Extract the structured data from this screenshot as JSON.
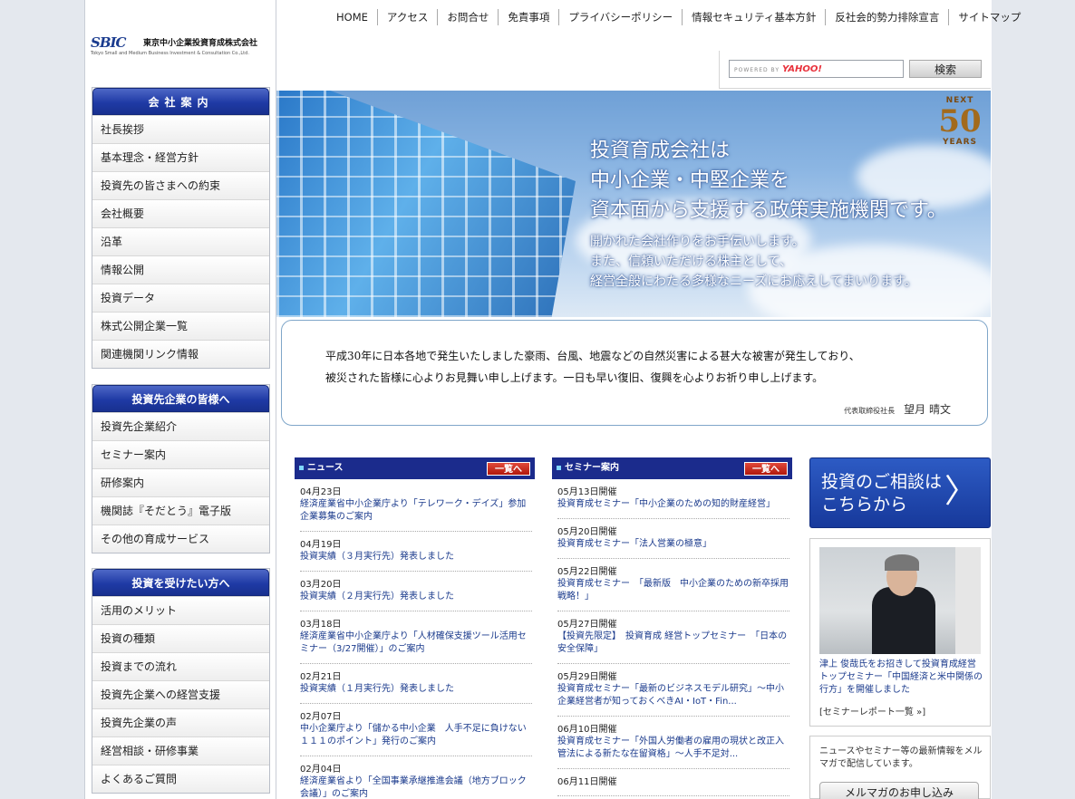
{
  "logo": {
    "mark": "SBIC",
    "name_jp": "東京中小企業投資育成株式会社",
    "name_en": "Tokyo Small and Medium Business Investment & Consultation Co.,Ltd."
  },
  "topnav": [
    "HOME",
    "アクセス",
    "お問合せ",
    "免責事項",
    "プライバシーポリシー",
    "情報セキュリティ基本方針",
    "反社会的勢力排除宣言",
    "サイトマップ"
  ],
  "search": {
    "powered_by": "POWERED BY",
    "provider": "YAHOO!",
    "button": "検索"
  },
  "menus": [
    {
      "title": "会社案内",
      "items": [
        "社長挨拶",
        "基本理念・経営方針",
        "投資先の皆さまへの約束",
        "会社概要",
        "沿革",
        "情報公開",
        "投資データ",
        "株式公開企業一覧",
        "関連機関リンク情報"
      ]
    },
    {
      "title": "投資先企業の皆様へ",
      "items": [
        "投資先企業紹介",
        "セミナー案内",
        "研修案内",
        "機関誌『そだとう』電子版",
        "その他の育成サービス"
      ]
    },
    {
      "title": "投資を受けたい方へ",
      "items": [
        "活用のメリット",
        "投資の種類",
        "投資までの流れ",
        "投資先企業への経営支援",
        "投資先企業の声",
        "経営相談・研修事業",
        "よくあるご質問"
      ]
    }
  ],
  "hero": {
    "headline": [
      "投資育成会社は",
      "中小企業・中堅企業を",
      "資本面から支援する政策実施機関です。"
    ],
    "sub": [
      "開かれた会社作りをお手伝いします。",
      "また、信頼いただける株主として、",
      "経営全般にわたる多様なニーズにお応えしてまいります。"
    ],
    "badge": {
      "top": "NEXT",
      "number": "50",
      "bottom": "YEARS"
    }
  },
  "message": {
    "line1": "平成30年に日本各地で発生いたしました豪雨、台風、地震などの自然災害による甚大な被害が発生しており、",
    "line2": "被災された皆様に心よりお見舞い申し上げます。一日も早い復旧、復興を心よりお祈り申し上げます。",
    "sig_title": "代表取締役社長",
    "sig_name": "望月 晴文"
  },
  "news": {
    "title": "ニュース",
    "more": "一覧へ",
    "items": [
      {
        "date": "04月23日",
        "text": "経済産業省中小企業庁より「テレワーク・デイズ」参加企業募集のご案内"
      },
      {
        "date": "04月19日",
        "text": "投資実績（３月実行先）発表しました"
      },
      {
        "date": "03月20日",
        "text": "投資実績（２月実行先）発表しました"
      },
      {
        "date": "03月18日",
        "text": "経済産業省中小企業庁より「人材確保支援ツール活用セミナー（3/27開催）」のご案内"
      },
      {
        "date": "02月21日",
        "text": "投資実績（１月実行先）発表しました"
      },
      {
        "date": "02月07日",
        "text": "中小企業庁より「儲かる中小企業　人手不足に負けない１１１のポイント」発行のご案内"
      },
      {
        "date": "02月04日",
        "text": "経済産業省より「全国事業承継推進会議（地方ブロック会議）」のご案内"
      }
    ]
  },
  "seminar": {
    "title": "セミナー案内",
    "more": "一覧へ",
    "items": [
      {
        "date": "05月13日開催",
        "text": "投資育成セミナー「中小企業のための知的財産経営」"
      },
      {
        "date": "05月20日開催",
        "text": "投資育成セミナー「法人営業の極意」"
      },
      {
        "date": "05月22日開催",
        "text": "投資育成セミナー　「最新版　中小企業のための新卒採用戦略！」"
      },
      {
        "date": "05月27日開催",
        "text": "【投資先限定】　投資育成 経営トップセミナー　「日本の安全保障」"
      },
      {
        "date": "05月29日開催",
        "text": "投資育成セミナー「最新のビジネスモデル研究」～中小企業経営者が知っておくべきAI・IoT・Fin..."
      },
      {
        "date": "06月10日開催",
        "text": "投資育成セミナー「外国人労働者の雇用の現状と改正入管法による新たな在留資格」～人手不足対..."
      },
      {
        "date": "06月11日開催",
        "text": ""
      }
    ]
  },
  "consult": {
    "line1": "投資のご相談は",
    "line2": "こちらから",
    "arrow": "〉"
  },
  "report": {
    "caption": "津上 俊哉氏をお招きして投資育成経営トップセミナー「中国経済と米中関係の行方」を開催しました",
    "list_link": "[セミナーレポート一覧 »]"
  },
  "mail": {
    "text": "ニュースやセミナー等の最新情報をメルマガで配信しています。",
    "button": "メルマガのお申し込み"
  }
}
